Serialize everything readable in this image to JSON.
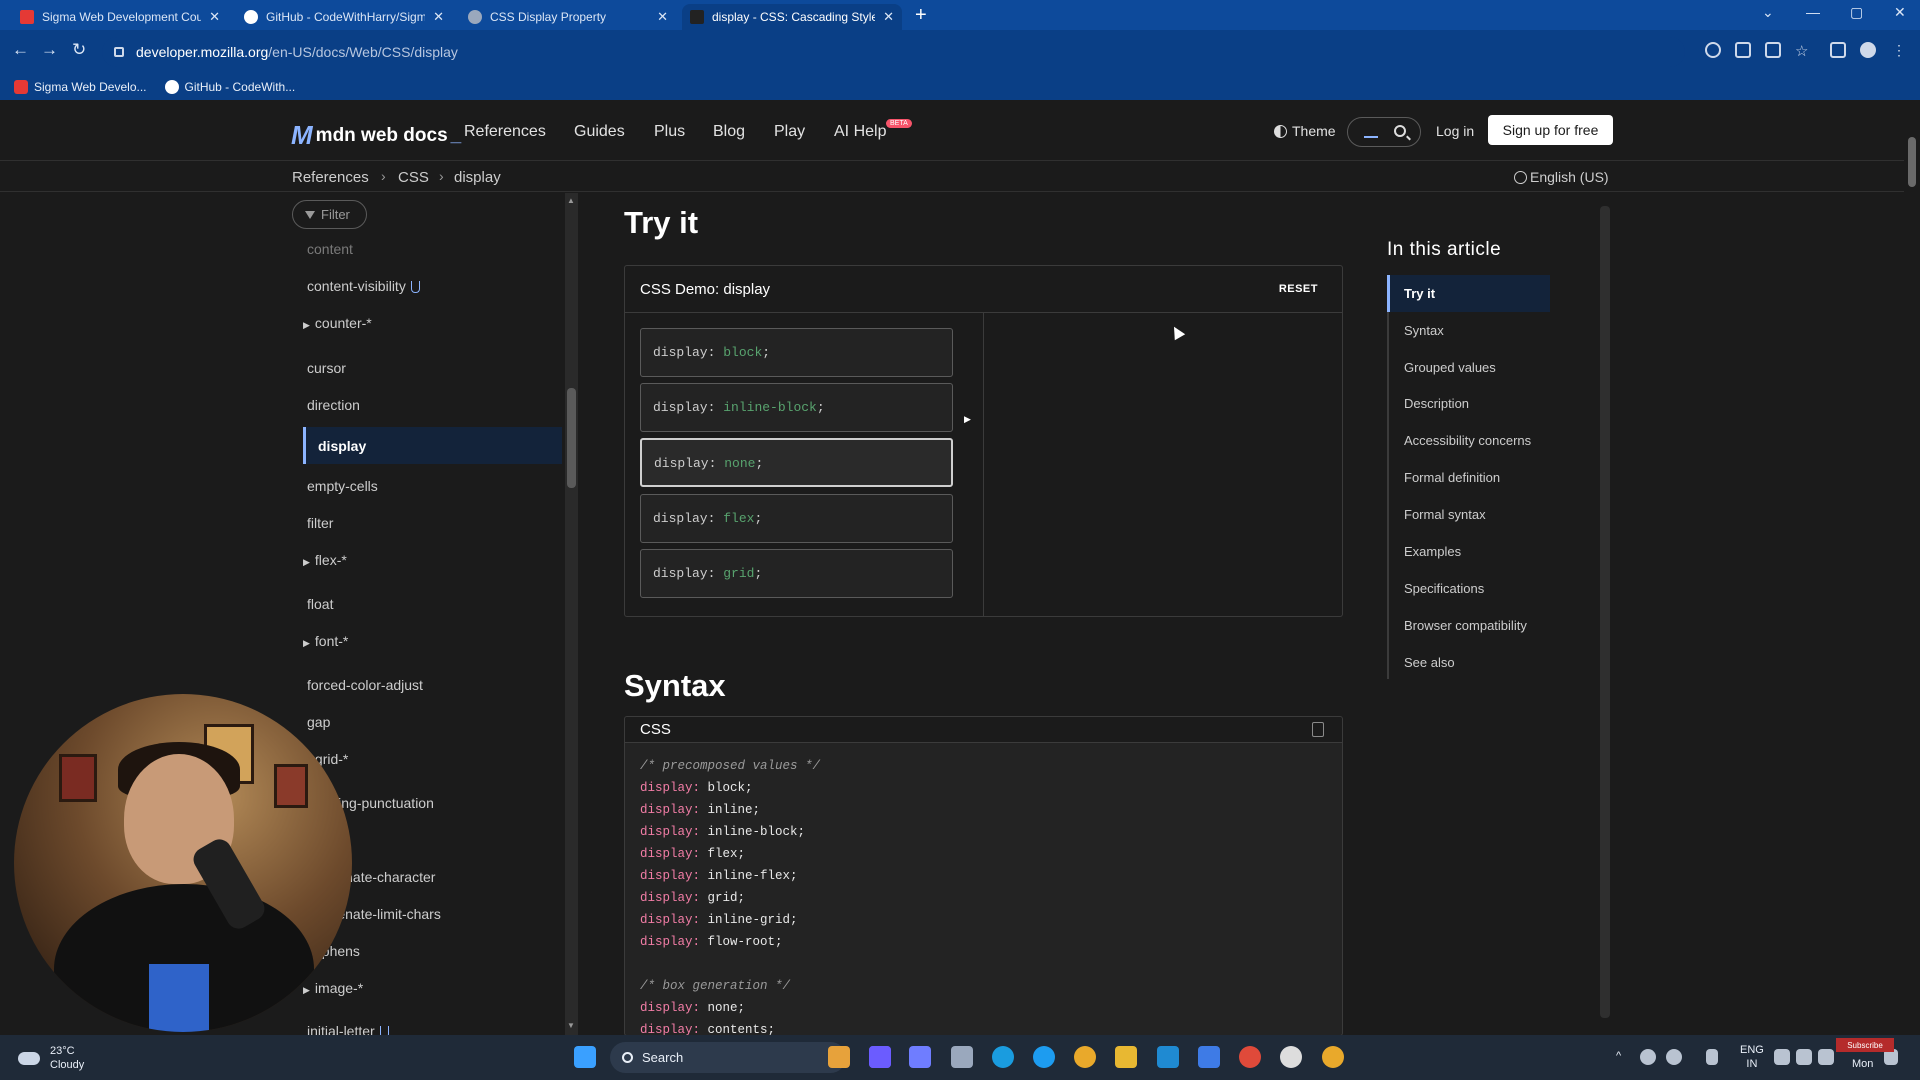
{
  "browser": {
    "tabs": [
      {
        "label": "Sigma Web Development Cours",
        "color": "#e53935"
      },
      {
        "label": "GitHub - CodeWithHarry/Sigma",
        "color": "#ffffff"
      },
      {
        "label": "CSS Display Property",
        "color": "#9aa8bd"
      },
      {
        "label": "display - CSS: Cascading Style S",
        "color": "#222222"
      }
    ],
    "url_host": "developer.mozilla.org",
    "url_path": "/en-US/docs/Web/CSS/display",
    "bookmarks": [
      "Sigma Web Develo...",
      "GitHub - CodeWith..."
    ],
    "colors": {
      "frame": "#0a3f86",
      "tabstrip": "#0d4a9b"
    }
  },
  "mdn_header": {
    "logo": "mdn web docs",
    "nav": [
      "References",
      "Guides",
      "Plus",
      "Blog",
      "Play",
      "AI Help"
    ],
    "beta": "BETA",
    "theme": "Theme",
    "login": "Log in",
    "signup": "Sign up for free"
  },
  "breadcrumb": [
    "References",
    "CSS",
    "display"
  ],
  "language": "English (US)",
  "sidebar": {
    "filter_placeholder": "Filter",
    "items": [
      {
        "label": "content",
        "dim": true
      },
      {
        "label": "content-visibility",
        "experimental": true
      },
      {
        "label": "counter-*",
        "expandable": true
      },
      {
        "label": "cursor"
      },
      {
        "label": "direction"
      },
      {
        "label": "display",
        "active": true
      },
      {
        "label": "empty-cells"
      },
      {
        "label": "filter"
      },
      {
        "label": "flex-*",
        "expandable": true
      },
      {
        "label": "float"
      },
      {
        "label": "font-*",
        "expandable": true
      },
      {
        "label": "forced-color-adjust"
      },
      {
        "label": "gap"
      },
      {
        "label": "grid-*",
        "expandable": true
      },
      {
        "label": "hanging-punctuation"
      },
      {
        "label": "hyphenate-character"
      },
      {
        "label": "hyphenate-limit-chars"
      },
      {
        "label": "hyphens"
      },
      {
        "label": "image-*",
        "expandable": true
      },
      {
        "label": "initial-letter",
        "experimental": true
      }
    ]
  },
  "main": {
    "tryit_heading": "Try it",
    "demo_title": "CSS Demo: display",
    "reset": "RESET",
    "options": [
      {
        "prop": "display:",
        "value": "block"
      },
      {
        "prop": "display:",
        "value": "inline-block"
      },
      {
        "prop": "display:",
        "value": "none",
        "selected": true
      },
      {
        "prop": "display:",
        "value": "flex"
      },
      {
        "prop": "display:",
        "value": "grid"
      }
    ],
    "syntax_heading": "Syntax",
    "code_lang": "CSS",
    "code_lines": [
      {
        "comment": "/* precomposed values */"
      },
      {
        "prop": "display:",
        "value": "block;"
      },
      {
        "prop": "display:",
        "value": "inline;"
      },
      {
        "prop": "display:",
        "value": "inline-block;"
      },
      {
        "prop": "display:",
        "value": "flex;"
      },
      {
        "prop": "display:",
        "value": "inline-flex;"
      },
      {
        "prop": "display:",
        "value": "grid;"
      },
      {
        "prop": "display:",
        "value": "inline-grid;"
      },
      {
        "prop": "display:",
        "value": "flow-root;"
      },
      {
        "blank": true
      },
      {
        "comment": "/* box generation */"
      },
      {
        "prop": "display:",
        "value": "none;"
      },
      {
        "prop": "display:",
        "value": "contents;"
      }
    ]
  },
  "toc": {
    "title": "In this article",
    "items": [
      "Try it",
      "Syntax",
      "Grouped values",
      "Description",
      "Accessibility concerns",
      "Formal definition",
      "Formal syntax",
      "Examples",
      "Specifications",
      "Browser compatibility",
      "See also"
    ]
  },
  "taskbar": {
    "temp": "23°C",
    "condition": "Cloudy",
    "search": "Search",
    "lang_top": "ENG",
    "lang_bottom": "IN",
    "day": "Mon",
    "subscribe": "Subscribe"
  }
}
